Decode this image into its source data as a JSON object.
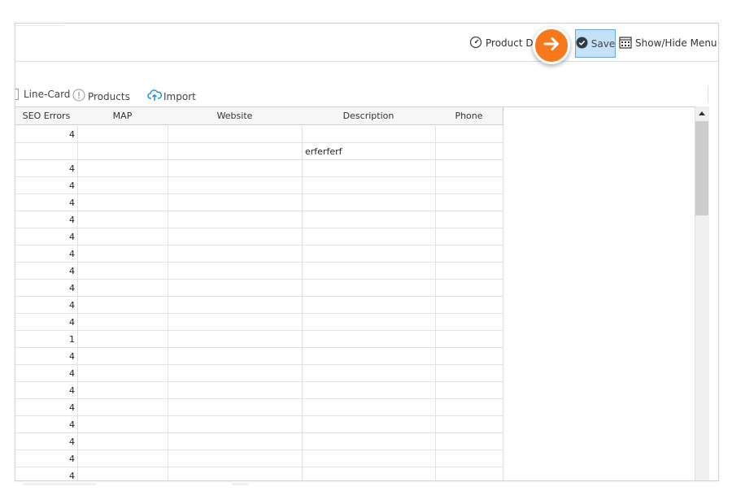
{
  "topbar": {
    "product_dashboard_label": "Product Da",
    "save_label": "Save",
    "show_hide_label": "Show/Hide Menu"
  },
  "toolbar": {
    "line_card_label": "Line-Card",
    "products_label": "Products",
    "import_label": "Import"
  },
  "grid": {
    "columns": [
      {
        "key": "seo",
        "label": "SEO Errors"
      },
      {
        "key": "map",
        "label": "MAP"
      },
      {
        "key": "website",
        "label": "Website"
      },
      {
        "key": "description",
        "label": "Description"
      },
      {
        "key": "phone",
        "label": "Phone"
      }
    ],
    "rows": [
      {
        "seo": "4",
        "map": "",
        "website": "",
        "description": "",
        "phone": ""
      },
      {
        "seo": "",
        "map": "",
        "website": "",
        "description": "erferferf",
        "phone": ""
      },
      {
        "seo": "4",
        "map": "",
        "website": "",
        "description": "",
        "phone": ""
      },
      {
        "seo": "4",
        "map": "",
        "website": "",
        "description": "",
        "phone": ""
      },
      {
        "seo": "4",
        "map": "",
        "website": "",
        "description": "",
        "phone": ""
      },
      {
        "seo": "4",
        "map": "",
        "website": "",
        "description": "",
        "phone": ""
      },
      {
        "seo": "4",
        "map": "",
        "website": "",
        "description": "",
        "phone": ""
      },
      {
        "seo": "4",
        "map": "",
        "website": "",
        "description": "",
        "phone": ""
      },
      {
        "seo": "4",
        "map": "",
        "website": "",
        "description": "",
        "phone": ""
      },
      {
        "seo": "4",
        "map": "",
        "website": "",
        "description": "",
        "phone": ""
      },
      {
        "seo": "4",
        "map": "",
        "website": "",
        "description": "",
        "phone": ""
      },
      {
        "seo": "4",
        "map": "",
        "website": "",
        "description": "",
        "phone": ""
      },
      {
        "seo": "1",
        "map": "",
        "website": "",
        "description": "",
        "phone": ""
      },
      {
        "seo": "4",
        "map": "",
        "website": "",
        "description": "",
        "phone": ""
      },
      {
        "seo": "4",
        "map": "",
        "website": "",
        "description": "",
        "phone": ""
      },
      {
        "seo": "4",
        "map": "",
        "website": "",
        "description": "",
        "phone": ""
      },
      {
        "seo": "4",
        "map": "",
        "website": "",
        "description": "",
        "phone": ""
      },
      {
        "seo": "4",
        "map": "",
        "website": "",
        "description": "",
        "phone": ""
      },
      {
        "seo": "4",
        "map": "",
        "website": "",
        "description": "",
        "phone": ""
      },
      {
        "seo": "4",
        "map": "",
        "website": "",
        "description": "",
        "phone": ""
      },
      {
        "seo": "4",
        "map": "",
        "website": "",
        "description": "",
        "phone": ""
      }
    ]
  },
  "icons": {
    "product_dashboard": "gauge-icon",
    "save": "check-circle-icon",
    "show_hide": "calendar-grid-icon",
    "products": "exclamation-circle-icon",
    "import": "cloud-upload-icon",
    "callout": "arrow-right-icon"
  },
  "colors": {
    "accent_orange": "#f7781a",
    "save_bg": "#c6e1f7",
    "save_border": "#6aa8d8",
    "import_icon": "#1b8ad8"
  }
}
